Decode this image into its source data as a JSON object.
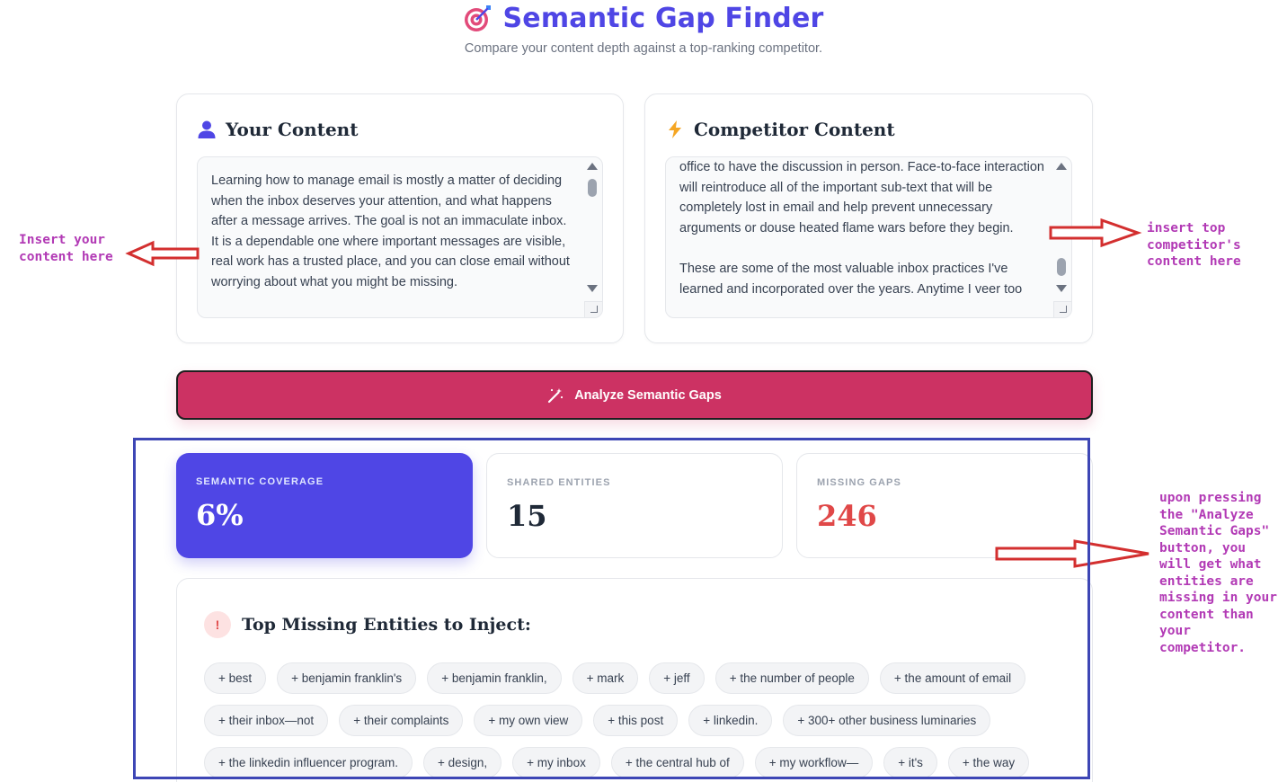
{
  "header": {
    "title": "Semantic Gap Finder",
    "subtitle": "Compare your content depth against a top-ranking competitor.",
    "icon": "target-dart-icon"
  },
  "your_content": {
    "label": "Your Content",
    "icon": "user-icon",
    "text": "Learning how to manage email is mostly a matter of deciding when the inbox deserves your attention, and what happens after a message arrives. The goal is not an immaculate inbox. It is a dependable one where important messages are visible, real work has a trusted place, and you can close email without worrying about what you might be missing."
  },
  "competitor_content": {
    "label": "Competitor Content",
    "icon": "lightning-bolt-icon",
    "text": "office to have the discussion in person. Face-to-face interaction will reintroduce all of the important sub-text that will be completely lost in email and help prevent unnecessary arguments or douse heated flame wars before they begin.\n\nThese are some of the most valuable inbox practices I've learned and incorporated over the years. Anytime I veer too"
  },
  "analyze_button": {
    "label": "Analyze Semantic Gaps",
    "icon": "magic-wand-icon",
    "color": "#cc3263"
  },
  "stats": {
    "coverage": {
      "label": "SEMANTIC COVERAGE",
      "value": "6%"
    },
    "shared": {
      "label": "SHARED ENTITIES",
      "value": "15"
    },
    "missing": {
      "label": "MISSING GAPS",
      "value": "246"
    }
  },
  "missing_entities": {
    "title": "Top Missing Entities to Inject:",
    "badge": "!",
    "chips": [
      "+ best",
      "+ benjamin franklin's",
      "+ benjamin franklin,",
      "+ mark",
      "+ jeff",
      "+ the number of people",
      "+ the amount of email",
      "+ their inbox—not",
      "+ their complaints",
      "+ my own view",
      "+ this post",
      "+ linkedin.",
      "+ 300+ other business luminaries",
      "+ the linkedin influencer program.",
      "+ design,",
      "+ my inbox",
      "+ the central hub of",
      "+ my workflow—",
      "+ it's",
      "+ the way"
    ]
  },
  "annotations": {
    "left": "Insert your\ncontent here",
    "right_top": "insert top\ncompetitor's\ncontent here",
    "right_bottom": "upon pressing\nthe \"Analyze\nSemantic Gaps\"\nbutton, you\nwill get what\nentities are\nmissing in your\ncontent than\nyour\ncompetitor."
  },
  "colors": {
    "brand": "#4f46e5",
    "accent": "#cc3263",
    "missing": "#e04848",
    "annotation": "#b23ab5",
    "annotation_arrow": "#d32f2f",
    "annotation_frame": "#3d46b5"
  }
}
